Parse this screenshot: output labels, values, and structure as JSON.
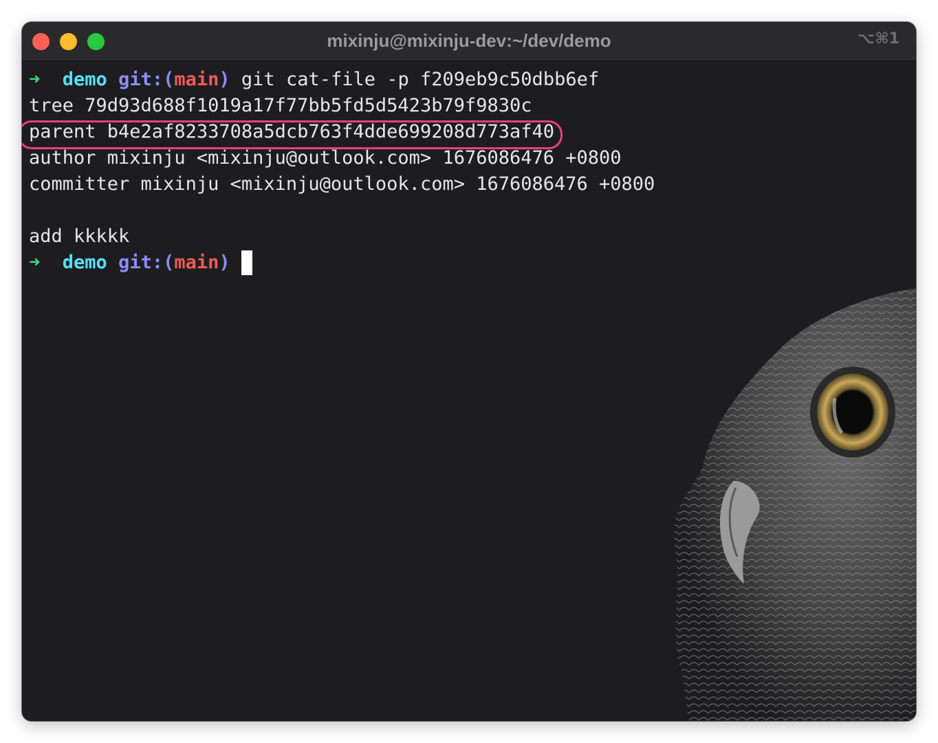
{
  "window": {
    "title": "mixinju@mixinju-dev:~/dev/demo",
    "shortcut": "⌥⌘1"
  },
  "colors": {
    "arrow": "#3ed685",
    "directory": "#53e0ff",
    "git_label": "#8c8cff",
    "branch": "#ee5a5a",
    "highlight_ring": "#ea3f7c",
    "background": "#1d1d1f"
  },
  "background_image": {
    "icon": "owl-illustration"
  },
  "prompt": {
    "arrow": "➜",
    "directory": "demo",
    "git_prefix": "git:(",
    "branch": "main",
    "git_suffix": ")"
  },
  "command": "git cat-file -p f209eb9c50dbb6ef",
  "output": {
    "tree": "tree 79d93d688f1019a17f77bb5fd5d5423b79f9830c",
    "parent": "parent b4e2af8233708a5dcb763f4dde699208d773af40",
    "author": "author mixinju <mixinju@outlook.com> 1676086476 +0800",
    "committer": "committer mixinju <mixinju@outlook.com> 1676086476 +0800",
    "message": "add kkkkk"
  }
}
